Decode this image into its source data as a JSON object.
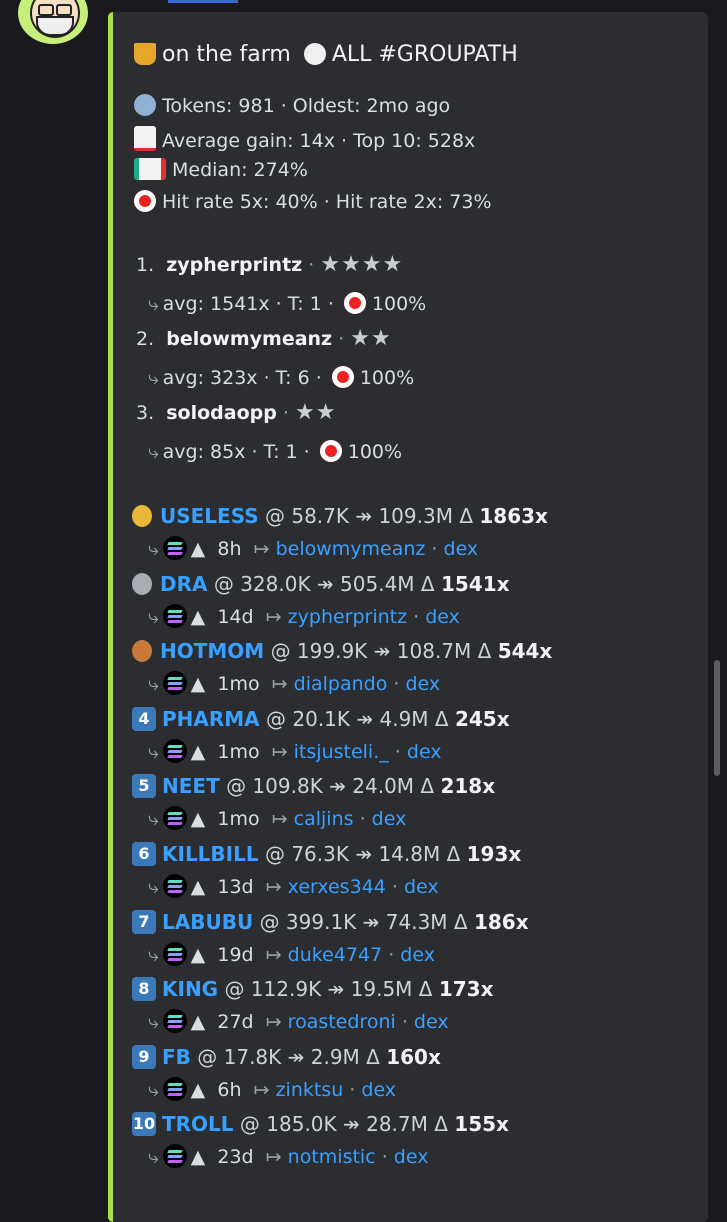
{
  "header": {
    "title": "on the farm",
    "title_suffix": "ALL #GROUPATH"
  },
  "stats": {
    "line1": "Tokens: 981 · Oldest: 2mo ago",
    "line2": "Average gain: 14x · Top 10: 528x",
    "line3": "Median: 274%",
    "line4": "Hit rate 5x: 40% · Hit rate 2x: 73%"
  },
  "leaders": [
    {
      "num": "1.",
      "name": "zypherprintz",
      "stars": "★★★★",
      "detail": "avg: 1541x · T: 1 ·",
      "rate": "100%"
    },
    {
      "num": "2.",
      "name": "belowmymeanz",
      "stars": "★★",
      "detail": "avg: 323x · T: 6 ·",
      "rate": "100%"
    },
    {
      "num": "3.",
      "name": "solodaopp",
      "stars": "★★",
      "detail": "avg: 85x · T: 1 ·",
      "rate": "100%"
    }
  ],
  "tokens": [
    {
      "badge": "1",
      "name": "USELESS",
      "price": "@ 58.7K ↠ 109.3M Δ",
      "mult": "1863x",
      "age": "8h",
      "caller": "belowmymeanz",
      "dex": "dex"
    },
    {
      "badge": "2",
      "name": "DRA",
      "price": "@ 328.0K ↠ 505.4M Δ",
      "mult": "1541x",
      "age": "14d",
      "caller": "zypherprintz",
      "dex": "dex"
    },
    {
      "badge": "3",
      "name": "HOTMOM",
      "price": "@ 199.9K ↠ 108.7M Δ",
      "mult": "544x",
      "age": "1mo",
      "caller": "dialpando",
      "dex": "dex"
    },
    {
      "badge": "4",
      "name": "PHARMA",
      "price": "@ 20.1K ↠ 4.9M Δ",
      "mult": "245x",
      "age": "1mo",
      "caller": "itsjusteli._",
      "dex": "dex"
    },
    {
      "badge": "5",
      "name": "NEET",
      "price": "@ 109.8K ↠ 24.0M Δ",
      "mult": "218x",
      "age": "1mo",
      "caller": "caljins",
      "dex": "dex"
    },
    {
      "badge": "6",
      "name": "KILLBILL",
      "price": "@ 76.3K ↠ 14.8M Δ",
      "mult": "193x",
      "age": "13d",
      "caller": "xerxes344",
      "dex": "dex"
    },
    {
      "badge": "7",
      "name": "LABUBU",
      "price": "@ 399.1K ↠ 74.3M Δ",
      "mult": "186x",
      "age": "19d",
      "caller": "duke4747",
      "dex": "dex"
    },
    {
      "badge": "8",
      "name": "KING",
      "price": "@ 112.9K ↠ 19.5M Δ",
      "mult": "173x",
      "age": "27d",
      "caller": "roastedroni",
      "dex": "dex"
    },
    {
      "badge": "9",
      "name": "FB",
      "price": "@ 17.8K ↠ 2.9M Δ",
      "mult": "160x",
      "age": "6h",
      "caller": "zinktsu",
      "dex": "dex"
    },
    {
      "badge": "10",
      "name": "TROLL",
      "price": "@ 185.0K ↠ 28.7M Δ",
      "mult": "155x",
      "age": "23d",
      "caller": "notmistic",
      "dex": "dex"
    }
  ],
  "colors": {
    "accent": "#a8e04a",
    "link": "#3aa0ff",
    "embed_bg": "#2b2d31",
    "page_bg": "#1a1a1e"
  }
}
